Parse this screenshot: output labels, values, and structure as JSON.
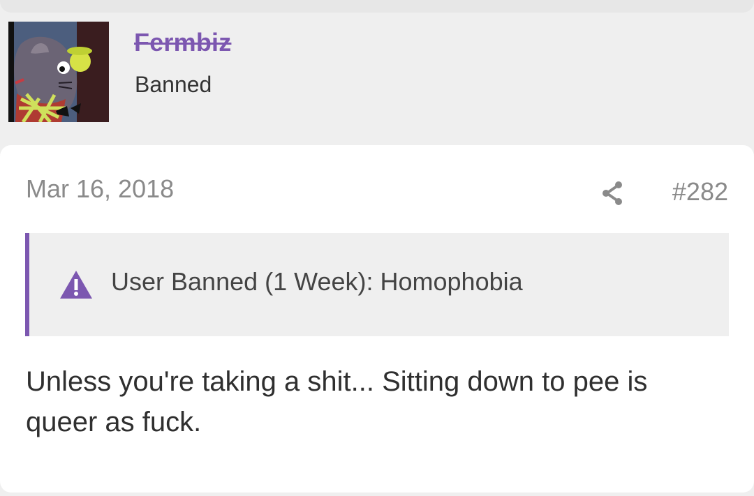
{
  "user": {
    "name": "Fermbiz",
    "title": "Banned",
    "avatar_icon": "cartoon-mouse-avatar"
  },
  "post": {
    "date": "Mar 16, 2018",
    "number": "#282",
    "share_icon": "share-icon",
    "ban_notice": {
      "icon": "warning-triangle-icon",
      "text": "User Banned (1 Week): Homophobia"
    },
    "body": "Unless you're taking a shit... Sitting down to pee is queer as fuck."
  },
  "colors": {
    "accent": "#7c57b0",
    "muted_text": "#8a8a8a",
    "card_background": "#ffffff",
    "page_background": "#efefef"
  }
}
